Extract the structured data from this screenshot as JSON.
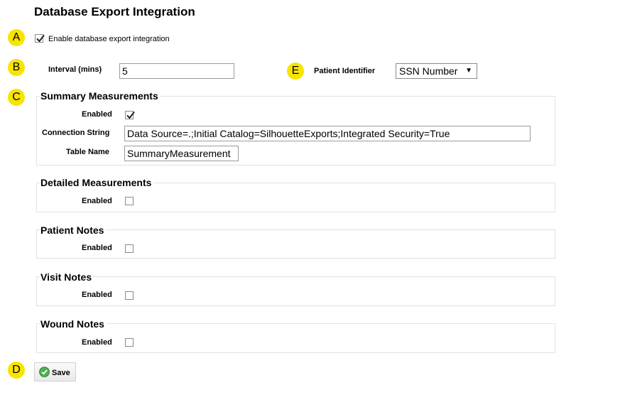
{
  "page": {
    "title": "Database Export Integration"
  },
  "markers": {
    "a": "A",
    "b": "B",
    "c": "C",
    "d": "D",
    "e": "E"
  },
  "enable": {
    "label": "Enable database export integration",
    "checked": true
  },
  "interval": {
    "label": "Interval (mins)",
    "value": "5"
  },
  "patient_identifier": {
    "label": "Patient Identifier",
    "selected": "SSN Number"
  },
  "sections": {
    "summary": {
      "title": "Summary Measurements",
      "enabled_label": "Enabled",
      "enabled": true,
      "connection_label": "Connection String",
      "connection_value": "Data Source=.;Initial Catalog=SilhouetteExports;Integrated Security=True",
      "table_label": "Table Name",
      "table_value": "SummaryMeasurement"
    },
    "detailed": {
      "title": "Detailed Measurements",
      "enabled_label": "Enabled",
      "enabled": false
    },
    "patient_notes": {
      "title": "Patient Notes",
      "enabled_label": "Enabled",
      "enabled": false
    },
    "visit_notes": {
      "title": "Visit Notes",
      "enabled_label": "Enabled",
      "enabled": false
    },
    "wound_notes": {
      "title": "Wound Notes",
      "enabled_label": "Enabled",
      "enabled": false
    }
  },
  "save": {
    "label": "Save"
  },
  "colors": {
    "marker": "#f7e400",
    "ok_icon": "#4caf50"
  },
  "icons": {
    "check": "checkmark-icon",
    "ok": "ok-circle-icon"
  }
}
